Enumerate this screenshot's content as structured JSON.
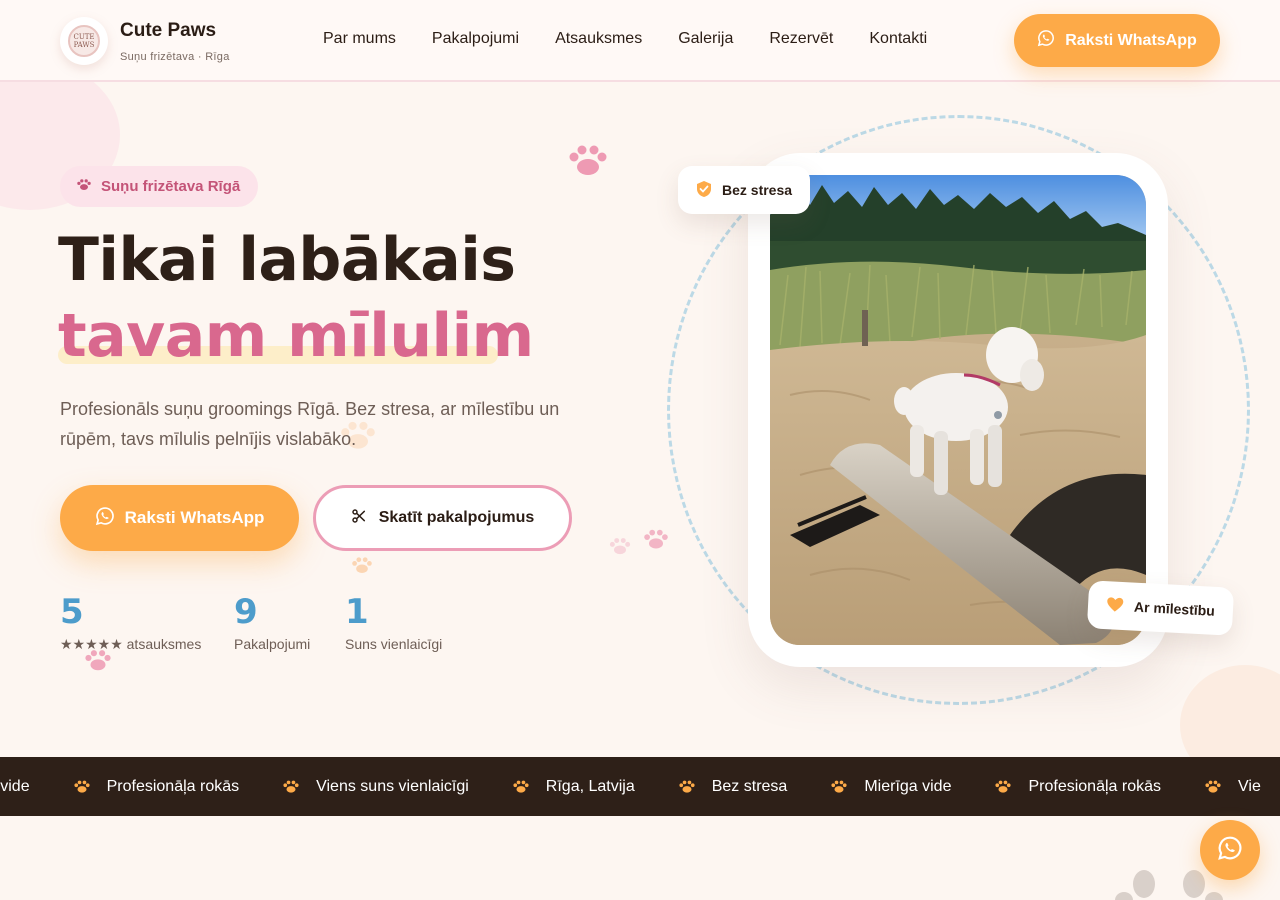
{
  "header": {
    "brand": "Cute Paws",
    "subtitle": "Suņu frizētava · Rīga",
    "logo_text_top": "CUTE",
    "logo_text_bottom": "PAWS",
    "nav": [
      "Par mums",
      "Pakalpojumi",
      "Atsauksmes",
      "Galerija",
      "Rezervēt",
      "Kontakti"
    ],
    "cta": "Raksti WhatsApp"
  },
  "hero": {
    "badge": "Suņu frizētava Rīgā",
    "title_line1": "Tikai labākais",
    "title_line2": "tavam mīlulim",
    "lead": "Profesionāls suņu groomings Rīgā. Bez stresa, ar mīlestību un rūpēm, tavs mīlulis pelnījis vislabāko.",
    "cta_primary": "Raksti WhatsApp",
    "cta_secondary": "Skatīt pakalpojumus",
    "stats": [
      {
        "value": "5",
        "label": "★★★★★ atsauksmes"
      },
      {
        "value": "9",
        "label": "Pakalpojumi"
      },
      {
        "value": "1",
        "label": "Suns vienlaicīgi"
      }
    ],
    "chip_top": "Bez stresa",
    "chip_bottom": "Ar mīlestību"
  },
  "marquee": [
    "ga vide",
    "Profesionāļa rokās",
    "Viens suns vienlaicīgi",
    "Rīga, Latvija",
    "Bez stresa",
    "Mierīga vide",
    "Profesionāļa rokās",
    "Vie"
  ],
  "colors": {
    "accent_orange": "#fdaa48",
    "accent_pink": "#d9688e",
    "stat_blue": "#4d9ccb",
    "dark": "#2e2018",
    "background": "#fdf6f1"
  },
  "icons": {
    "header_cta": "whatsapp-icon",
    "badge": "paw-icon",
    "secondary_cta": "scissors-icon",
    "chip_top": "shield-icon",
    "chip_bottom": "heart-icon",
    "fab": "whatsapp-icon"
  }
}
